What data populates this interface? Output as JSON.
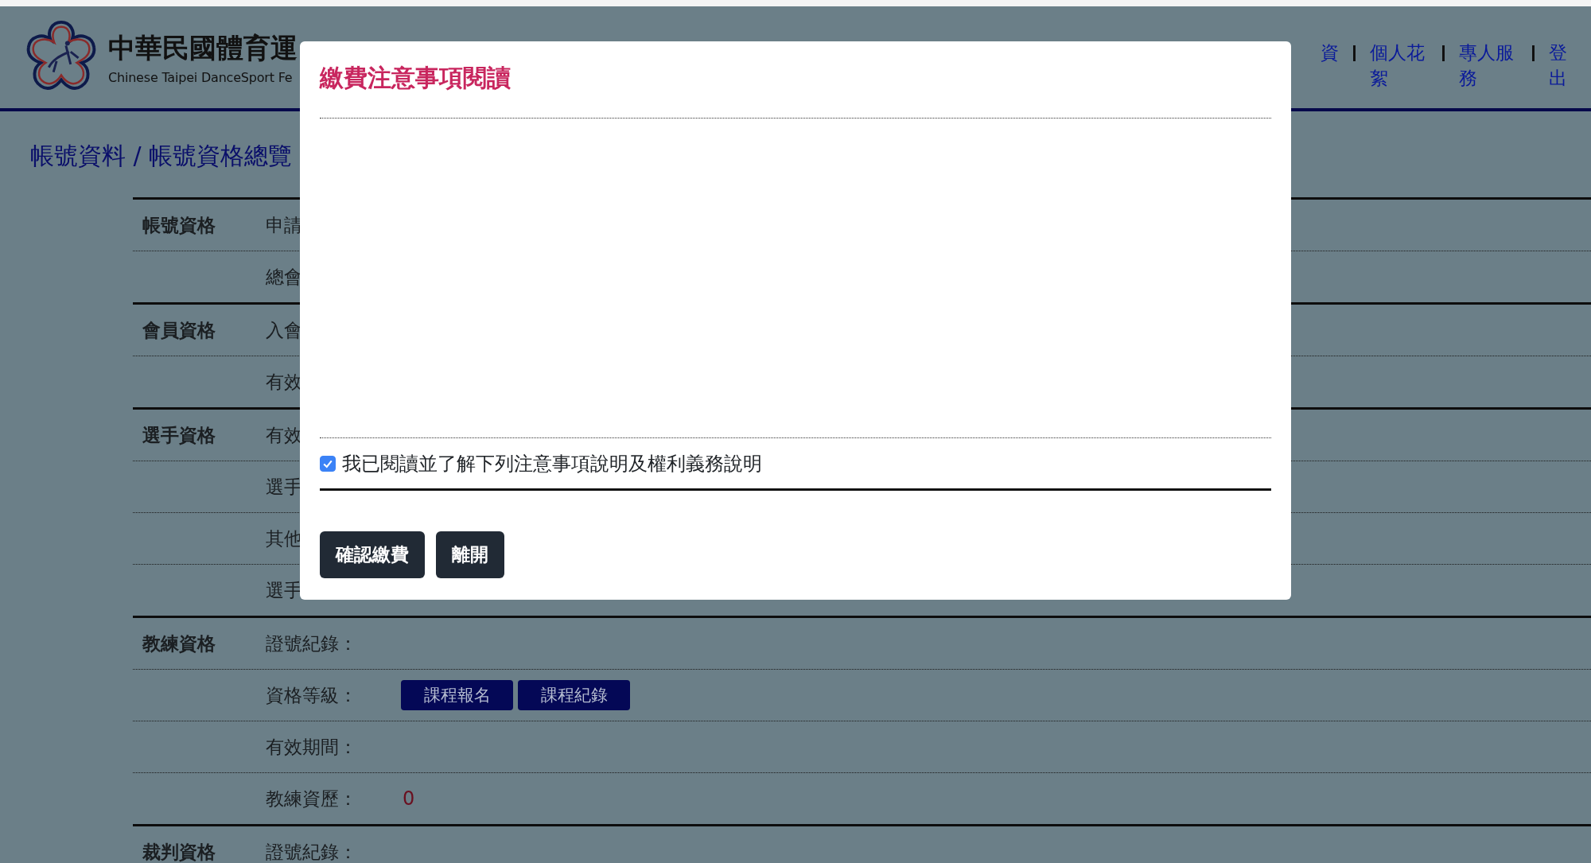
{
  "header": {
    "title": "中華民國體育運",
    "subtitle": "Chinese Taipei DanceSport Fe",
    "nav": [
      {
        "label": "資"
      },
      {
        "label": "個人花絮"
      },
      {
        "label": "專人服務"
      },
      {
        "label": "登出"
      }
    ]
  },
  "breadcrumb": "帳號資料 / 帳號資格總覽",
  "groups": [
    {
      "label": "帳號資格",
      "rows": [
        {
          "label": "申請"
        },
        {
          "label": "總會"
        }
      ]
    },
    {
      "label": "會員資格",
      "rows": [
        {
          "label": "入會"
        },
        {
          "label": "有效"
        }
      ]
    },
    {
      "label": "選手資格",
      "rows": [
        {
          "label": "有效"
        },
        {
          "label": "選手"
        },
        {
          "label": "其他"
        },
        {
          "label": "選手"
        }
      ]
    },
    {
      "label": "教練資格",
      "rows": [
        {
          "label": "證號紀錄："
        },
        {
          "label": "資格等級：",
          "buttons": [
            "課程報名",
            "課程紀錄"
          ]
        },
        {
          "label": "有效期間："
        },
        {
          "label": "教練資歷：",
          "value": "0"
        }
      ]
    },
    {
      "label": "裁判資格",
      "rows": [
        {
          "label": "證號紀錄："
        }
      ]
    }
  ],
  "modal": {
    "title": "繳費注意事項閱讀",
    "agree": {
      "label": "我已閱讀並了解下列注意事項說明及權利義務說明",
      "checked": true
    },
    "buttons": [
      "確認繳費",
      "離開"
    ]
  }
}
